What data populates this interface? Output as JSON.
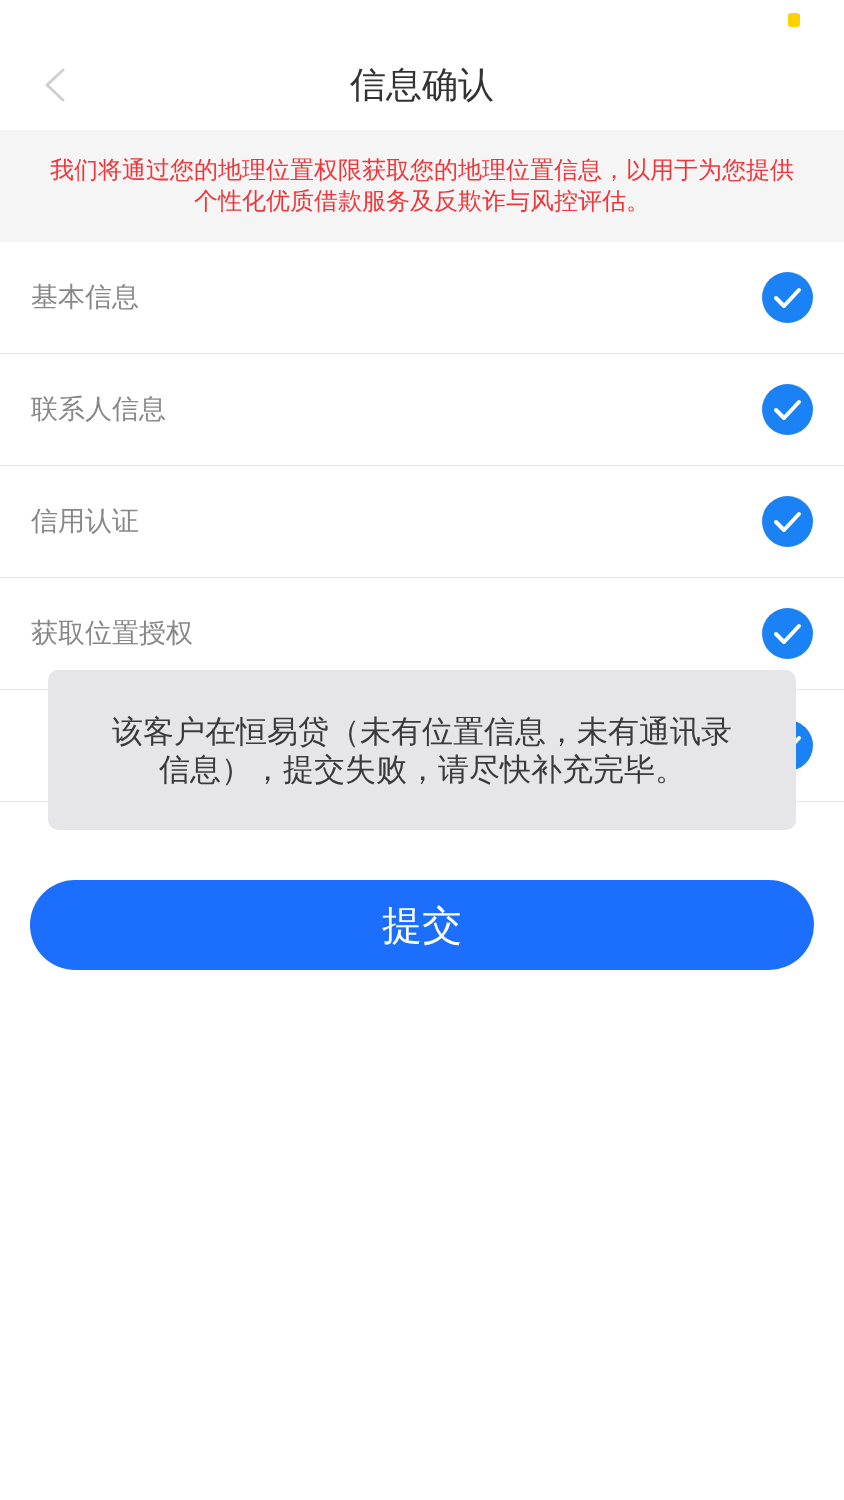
{
  "title": "信息确认",
  "notice": "我们将通过您的地理位置权限获取您的地理位置信息，以用于为您提供个性化优质借款服务及反欺诈与风控评估。",
  "items": [
    {
      "label": "基本信息",
      "checked": true
    },
    {
      "label": "联系人信息",
      "checked": true
    },
    {
      "label": "信用认证",
      "checked": true
    },
    {
      "label": "获取位置授权",
      "checked": true
    },
    {
      "checked": true
    }
  ],
  "toast": "该客户在恒易贷（未有位置信息，未有通讯录信息），提交失败，请尽快补充完毕。",
  "submit_button": "提交"
}
